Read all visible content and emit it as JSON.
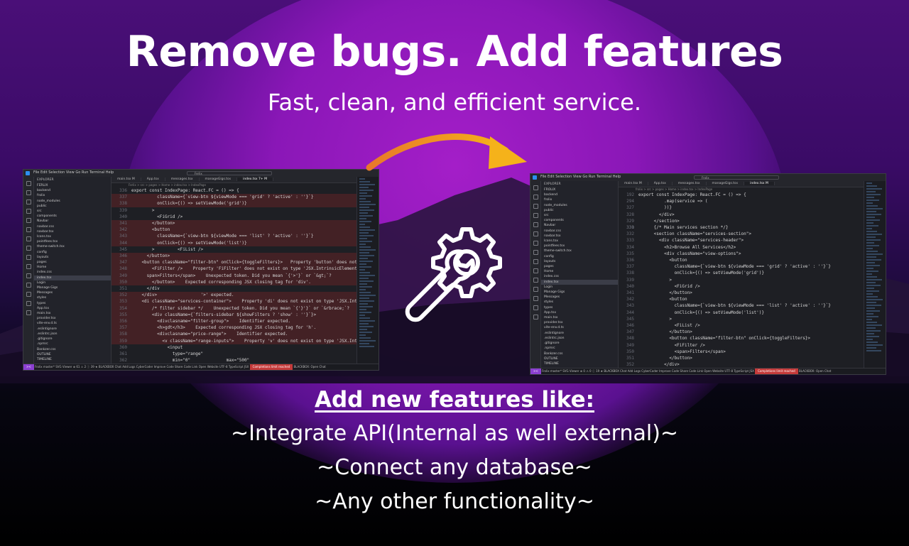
{
  "hero": {
    "title": "Remove bugs. Add features",
    "subtitle": "Fast, clean, and efficient service."
  },
  "colors": {
    "accent_purple": "#a41ec8",
    "arrow_start": "#e8782a",
    "arrow_end": "#f5b21a",
    "error_highlight": "#c53a3a"
  },
  "before_screenshot": {
    "menu": "File  Edit  Selection  View  Go  Run  Terminal  Help",
    "search": "Ferlix",
    "explorer_header": "EXPLORER",
    "tree": [
      "FERLIX",
      "backend",
      "frolix",
      "node_modules",
      "public",
      "src",
      "components",
      "Navbar",
      "navbar.css",
      "navbar.tsx",
      "Icons.tsx",
      "pointfees.tsx",
      "theme-switch.tsx",
      "config",
      "layouts",
      "pages",
      "Home",
      "index.css",
      "index.tsx",
      "Login",
      "Manage Gigs",
      "Messages",
      "styles",
      "types",
      "App.tsx",
      "main.tsx",
      "provider.tsx",
      "vite-env.d.ts",
      ".eslintignore",
      ".eslintrc.json",
      ".gitignore",
      ".npmrc",
      "Bankzer.css",
      "OUTLINE",
      "TIMELINE"
    ],
    "tabs": [
      "main.tsx M",
      "App.tsx",
      "messages.tsx",
      "manageGigs.tsx",
      "index.tsx 7+ M"
    ],
    "breadcrumb": "Ferlix > src > pages > Home > index.tsx > IndexPage",
    "code_lines": [
      {
        "n": "336",
        "t": "export const IndexPage: React.FC = () => {",
        "err": false
      },
      {
        "n": "337",
        "t": "          className={`view-btn ${viewMode === 'grid' ? 'active' : ''}`}",
        "err": true
      },
      {
        "n": "338",
        "t": "          onClick={() => setViewMode('grid')}",
        "err": true
      },
      {
        "n": "339",
        "t": "        >",
        "err": false
      },
      {
        "n": "340",
        "t": "          <FiGrid />",
        "err": false
      },
      {
        "n": "341",
        "t": "        </button>",
        "err": true
      },
      {
        "n": "342",
        "t": "        <button",
        "err": true
      },
      {
        "n": "343",
        "t": "          className={`view-btn ${viewMode === 'list' ? 'active' : ''}`}",
        "err": true
      },
      {
        "n": "344",
        "t": "          onClick={() => setViewMode('list')}",
        "err": true
      },
      {
        "n": "345",
        "t": "        >         <FiList />",
        "err": false
      },
      {
        "n": "346",
        "t": "      </button>",
        "err": true
      },
      {
        "n": "347",
        "t": "    <button className=\"filter-btn\" onClick={toggleFilters}>   Property 'button' does not exist on",
        "err": true
      },
      {
        "n": "348",
        "t": "        <FiFilter />    Property 'FiFilter' does not exist on type 'JSX.IntrinsicElements'.",
        "err": true
      },
      {
        "n": "349",
        "t": "      span>Filters</span>    Unexpected token. Did you mean `{'>'}` or `&gt;`?",
        "err": true
      },
      {
        "n": "350",
        "t": "        </button>    Expected corresponding JSX closing tag for 'div'.",
        "err": true
      },
      {
        "n": "351",
        "t": "      </div",
        "err": false
      },
      {
        "n": "352",
        "t": "    </div>                 '>' expected.",
        "err": true
      },
      {
        "n": "353",
        "t": "    <di className=\"services-container\">    Property 'di' does not exist on type 'JSX.IntrinsicElements",
        "err": true
      },
      {
        "n": "354",
        "t": "        /* filter sidebar */    Unexpected token. Did you mean `{'}'}` or `&rbrace;`?",
        "err": true
      },
      {
        "n": "355",
        "t": "        <div className={`filters-sidebar ${showFilters ? 'show' : ''}`}>",
        "err": true
      },
      {
        "n": "356",
        "t": "          <divclasname=\"filter-group\">    Identifier expected.",
        "err": true
      },
      {
        "n": "357",
        "t": "          <h>gdt</h3>    Expected corresponding JSX closing tag for 'h'.",
        "err": true
      },
      {
        "n": "358",
        "t": "          <divclasname=\"price-range\">    Identifier expected.",
        "err": true
      },
      {
        "n": "359",
        "t": "            <v className=\"range-inputs\">    Property 'v' does not exist on type 'JSX.IntrinsicElem",
        "err": true
      },
      {
        "n": "360",
        "t": "              <input",
        "err": false
      },
      {
        "n": "361",
        "t": "                type=\"range\"",
        "err": false
      },
      {
        "n": "362",
        "t": "                min=\"0\"              max=\"500\"",
        "err": false
      },
      {
        "n": "363",
        "t": "                value={priceRange[0]}",
        "err": false
      },
      {
        "n": "364",
        "t": "                onChange={(e) => handlePriceChange(e, 0)}",
        "err": false
      },
      {
        "n": "365",
        "t": "              />",
        "err": true
      },
      {
        "n": "366",
        "t": "              <input      '>' expected.",
        "err": true
      }
    ],
    "status": {
      "remote": "><",
      "left": "Frolix   master*   SVG Viewer   ⊗ 61 ⚠ 2   ⓘ 39   ★ BLACKBOX Chat   Add Logs   CyberCoder   Improve Code   Share Code Link   Open Website",
      "right": "UTF-8   TypeScript JSX",
      "warning": "Completions limit reached",
      "tail": "BLACKBOX: Open Chat"
    }
  },
  "after_screenshot": {
    "menu": "File  Edit  Selection  View  Go  Run  Terminal  Help",
    "search": "Frolix",
    "explorer_header": "EXPLORER",
    "tree": [
      "FROLIX",
      "backend",
      "frolix",
      "node_modules",
      "public",
      "src",
      "components",
      "Navbar",
      "navbar.css",
      "navbar.tsx",
      "Icons.tsx",
      "pointfees.tsx",
      "theme-switch.tsx",
      "config",
      "layouts",
      "pages",
      "Home",
      "index.css",
      "index.tsx",
      "Login",
      "Manage Gigs",
      "Messages",
      "styles",
      "types",
      "App.tsx",
      "main.tsx",
      "provider.tsx",
      "vite-env.d.ts",
      ".eslintignore",
      ".eslintrc.json",
      ".gitignore",
      ".npmrc",
      "Bankzer.css",
      "OUTLINE",
      "TIMELINE"
    ],
    "tabs": [
      "main.tsx M",
      "App.tsx",
      "messages.tsx",
      "manageGigs.tsx",
      "index.tsx M"
    ],
    "breadcrumb": "frolix > src > pages > Home > index.tsx > IndexPage",
    "code_lines": [
      {
        "n": "192",
        "t": "export const IndexPage: React.FC = () => {",
        "err": false
      },
      {
        "n": "294",
        "t": "          .map(service => (",
        "err": false
      },
      {
        "n": "327",
        "t": "          ))}",
        "err": false
      },
      {
        "n": "328",
        "t": "        </div>",
        "err": false
      },
      {
        "n": "329",
        "t": "      </section>",
        "err": false
      },
      {
        "n": "330",
        "t": "",
        "err": false
      },
      {
        "n": "331",
        "t": "      {/* Main services section */}",
        "err": false
      },
      {
        "n": "332",
        "t": "      <section className=\"services-section\">",
        "err": false
      },
      {
        "n": "333",
        "t": "        <div className=\"services-header\">",
        "err": false
      },
      {
        "n": "334",
        "t": "          <h2>Browse All Services</h2>",
        "err": false
      },
      {
        "n": "335",
        "t": "          <div className=\"view-options\">",
        "err": false
      },
      {
        "n": "336",
        "t": "            <button",
        "err": false
      },
      {
        "n": "337",
        "t": "              className={`view-btn ${viewMode === 'grid' ? 'active' : ''}`}",
        "err": false
      },
      {
        "n": "338",
        "t": "              onClick={() => setViewMode('grid')}",
        "err": false
      },
      {
        "n": "339",
        "t": "            >",
        "err": false
      },
      {
        "n": "340",
        "t": "              <FiGrid />",
        "err": false
      },
      {
        "n": "341",
        "t": "            </button>",
        "err": false
      },
      {
        "n": "342",
        "t": "            <button",
        "err": false
      },
      {
        "n": "343",
        "t": "              className={`view-btn ${viewMode === 'list' ? 'active' : ''}`}",
        "err": false
      },
      {
        "n": "344",
        "t": "              onClick={() => setViewMode('list')}",
        "err": false
      },
      {
        "n": "345",
        "t": "            >",
        "err": false
      },
      {
        "n": "346",
        "t": "              <FiList />",
        "err": false
      },
      {
        "n": "347",
        "t": "            </button>",
        "err": false
      },
      {
        "n": "348",
        "t": "            <button className=\"filter-btn\" onClick={toggleFilters}>",
        "err": false
      },
      {
        "n": "349",
        "t": "              <FiFilter />",
        "err": false
      },
      {
        "n": "350",
        "t": "              <span>Filters</span>",
        "err": false
      },
      {
        "n": "351",
        "t": "            </button>",
        "err": false
      },
      {
        "n": "352",
        "t": "          </div>",
        "err": false
      },
      {
        "n": "353",
        "t": "        </div>",
        "err": false
      },
      {
        "n": "354",
        "t": "",
        "err": false
      },
      {
        "n": "355",
        "t": "        <div className=\"services-container\">",
        "err": false
      }
    ],
    "status": {
      "remote": "><",
      "left": "Frolix   master*   SVG Viewer   ⊗ 0 ⚠ 0   ⓘ 19   ★ BLACKBOX Chat   Add Logs   CyberCoder   Improve Code   Share Code Link   Open Website",
      "right": "UTF-8   TypeScript JSX",
      "warning": "Completions limit reached",
      "tail": "BLACKBOX: Open Chat"
    }
  },
  "features": {
    "title": "Add new features like:",
    "items": [
      "~Integrate API(Internal as well external)~",
      "~Connect any database~",
      "~Any other functionality~"
    ]
  }
}
